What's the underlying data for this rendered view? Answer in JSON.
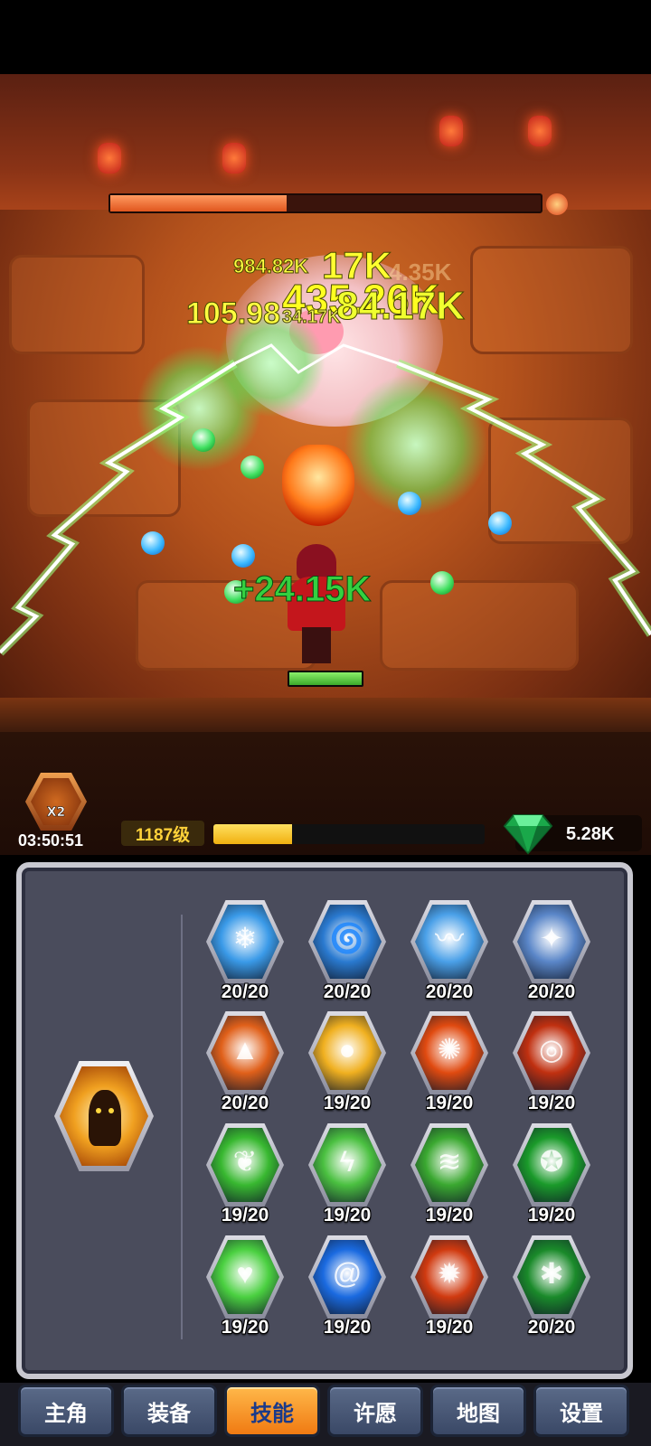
{
  "battle": {
    "boss_hp_fraction": 0.41,
    "hero_hp_fraction": 1.0,
    "damage_numbers": [
      "984.82K",
      "17K",
      "435.26K",
      "4.35K",
      "105.98",
      "34.17K",
      "84.17K"
    ],
    "heal_number": "+24.15K"
  },
  "hud": {
    "boost_multiplier": "X2",
    "boost_timer": "03:50:51",
    "level_label": "1187级",
    "xp_fraction": 0.29,
    "gems": "5.28K"
  },
  "skills": {
    "character_icon": "fire-avatar-icon",
    "items": [
      {
        "icon": "ice-spikes-icon",
        "count": "20/20",
        "color": "#3a9ae8"
      },
      {
        "icon": "tornado-icon",
        "count": "20/20",
        "color": "#2a7ad0"
      },
      {
        "icon": "tidal-wave-icon",
        "count": "20/20",
        "color": "#4aa0e8"
      },
      {
        "icon": "ice-crystal-icon",
        "count": "20/20",
        "color": "#5a86c8"
      },
      {
        "icon": "fire-pillars-icon",
        "count": "20/20",
        "color": "#e0601a"
      },
      {
        "icon": "sun-orb-icon",
        "count": "19/20",
        "color": "#f0b020"
      },
      {
        "icon": "flame-burst-icon",
        "count": "19/20",
        "color": "#e04a10"
      },
      {
        "icon": "fire-ring-icon",
        "count": "19/20",
        "color": "#c03010"
      },
      {
        "icon": "green-feather-icon",
        "count": "19/20",
        "color": "#38b830"
      },
      {
        "icon": "green-lightning-icon",
        "count": "19/20",
        "color": "#4ac040"
      },
      {
        "icon": "green-swirl-icon",
        "count": "19/20",
        "color": "#3aa830"
      },
      {
        "icon": "pentagram-icon",
        "count": "19/20",
        "color": "#1a9a2a"
      },
      {
        "icon": "heart-ripple-icon",
        "count": "19/20",
        "color": "#4ad040"
      },
      {
        "icon": "blue-vortex-icon",
        "count": "19/20",
        "color": "#1a6ae0"
      },
      {
        "icon": "blaze-icon",
        "count": "19/20",
        "color": "#d03a10"
      },
      {
        "icon": "thorn-vines-icon",
        "count": "20/20",
        "color": "#1a8a2a"
      }
    ]
  },
  "nav": {
    "tabs": [
      "主角",
      "装备",
      "技能",
      "许愿",
      "地图",
      "设置"
    ],
    "active_index": 2
  },
  "colors": {
    "panel_bg": "#4a4c5c",
    "active_tab": "#f59a2a",
    "xp_bar": "#f0c020",
    "boss_hp": "#e86a2a",
    "damage_text": "#ffff30",
    "heal_text": "#30d040"
  }
}
